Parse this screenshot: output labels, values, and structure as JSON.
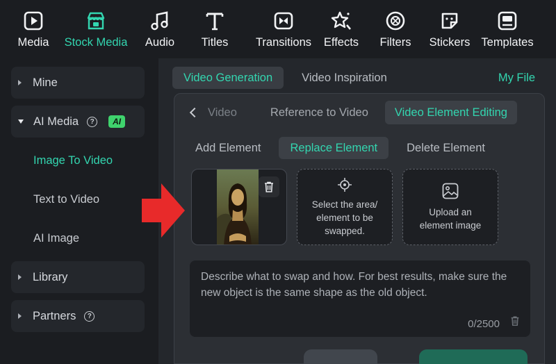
{
  "toolbar": {
    "items": [
      {
        "label": "Media",
        "icon": "media-icon"
      },
      {
        "label": "Stock Media",
        "icon": "stock-media-icon",
        "active": true
      },
      {
        "label": "Audio",
        "icon": "audio-note-icon"
      },
      {
        "label": "Titles",
        "icon": "titles-t-icon"
      },
      {
        "label": "Transitions",
        "icon": "transitions-icon"
      },
      {
        "label": "Effects",
        "icon": "effects-star-icon"
      },
      {
        "label": "Filters",
        "icon": "filters-icon"
      },
      {
        "label": "Stickers",
        "icon": "stickers-icon"
      },
      {
        "label": "Templates",
        "icon": "templates-icon"
      }
    ]
  },
  "sidebar": {
    "mine": "Mine",
    "ai_media": "AI Media",
    "ai_badge": "AI",
    "image_to_video": "Image To Video",
    "text_to_video": "Text to Video",
    "ai_image": "AI Image",
    "library": "Library",
    "partners": "Partners"
  },
  "main": {
    "tab_video_generation": "Video Generation",
    "tab_video_inspiration": "Video Inspiration",
    "my_file": "My File",
    "subtab_video": "Video",
    "subtab_reference": "Reference to Video",
    "subtab_element_editing": "Video Element Editing",
    "mode_add": "Add Element",
    "mode_replace": "Replace Element",
    "mode_delete": "Delete Element",
    "card_select": "Select the area/ element to be swapped.",
    "card_upload": "Upload an element image",
    "prompt_placeholder": "Describe what to swap and how. For best results, make sure the new object is the same shape as the old object.",
    "char_count": "0/2500"
  },
  "colors": {
    "accent": "#33d6b0",
    "ai_badge": "#3fd36d",
    "arrow": "#e82a2a"
  }
}
